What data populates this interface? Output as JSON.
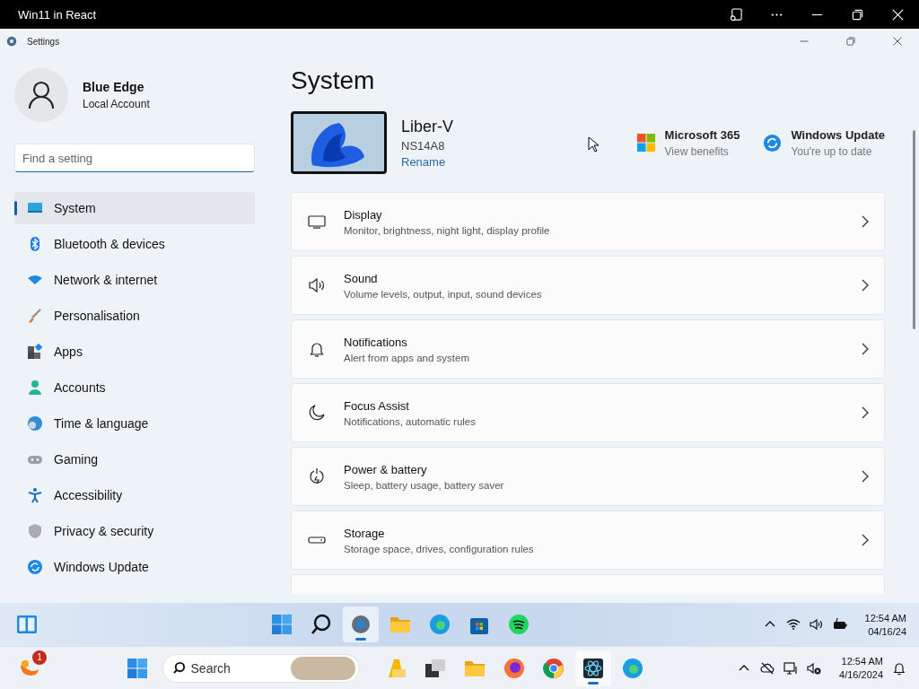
{
  "app_bar": {
    "title": "Win11 in React"
  },
  "window": {
    "title": "Settings"
  },
  "account": {
    "name": "Blue Edge",
    "type": "Local Account"
  },
  "search": {
    "placeholder": "Find a setting"
  },
  "nav": [
    {
      "label": "System",
      "selected": true
    },
    {
      "label": "Bluetooth & devices",
      "selected": false
    },
    {
      "label": "Network & internet",
      "selected": false
    },
    {
      "label": "Personalisation",
      "selected": false
    },
    {
      "label": "Apps",
      "selected": false
    },
    {
      "label": "Accounts",
      "selected": false
    },
    {
      "label": "Time & language",
      "selected": false
    },
    {
      "label": "Gaming",
      "selected": false
    },
    {
      "label": "Accessibility",
      "selected": false
    },
    {
      "label": "Privacy & security",
      "selected": false
    },
    {
      "label": "Windows Update",
      "selected": false
    }
  ],
  "page": {
    "title": "System"
  },
  "device": {
    "name": "Liber-V",
    "model": "NS14A8",
    "rename": "Rename"
  },
  "promos": [
    {
      "title": "Microsoft 365",
      "subtitle": "View benefits"
    },
    {
      "title": "Windows Update",
      "subtitle": "You're up to date"
    }
  ],
  "cards": [
    {
      "title": "Display",
      "subtitle": "Monitor, brightness, night light, display profile"
    },
    {
      "title": "Sound",
      "subtitle": "Volume levels, output, input, sound devices"
    },
    {
      "title": "Notifications",
      "subtitle": "Alert from apps and system"
    },
    {
      "title": "Focus Assist",
      "subtitle": "Notifications, automatic rules"
    },
    {
      "title": "Power & battery",
      "subtitle": "Sleep, battery usage, battery saver"
    },
    {
      "title": "Storage",
      "subtitle": "Storage space, drives, configuration rules"
    }
  ],
  "inner_taskbar": {
    "apps": [
      {
        "active": false
      },
      {
        "active": false
      },
      {
        "active": true
      },
      {
        "active": false
      },
      {
        "active": false
      },
      {
        "active": false
      },
      {
        "active": false
      }
    ],
    "clock": {
      "time": "12:54 AM",
      "date": "04/16/24"
    }
  },
  "taskbar": {
    "badge": "1",
    "search": {
      "placeholder": "Search"
    },
    "apps": [
      {
        "active": false
      },
      {
        "active": false
      },
      {
        "active": false
      },
      {
        "active": false
      },
      {
        "active": false
      },
      {
        "active": true
      },
      {
        "active": false
      }
    ],
    "clock": {
      "time": "12:54 AM",
      "date": "4/16/2024"
    }
  }
}
